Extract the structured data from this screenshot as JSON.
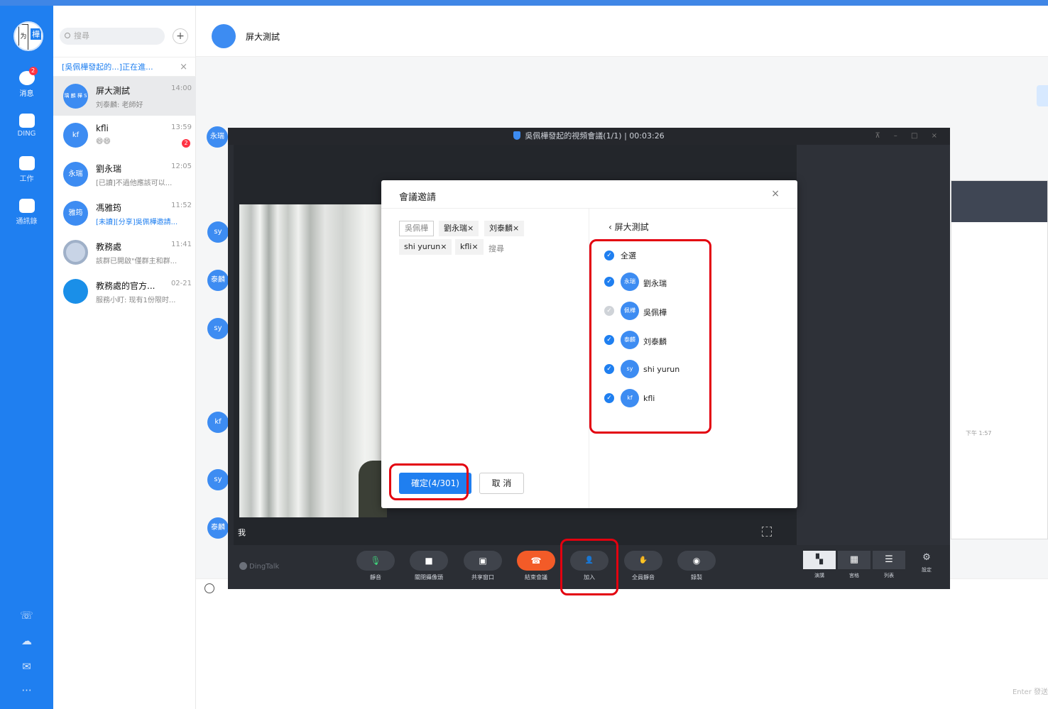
{
  "nav": {
    "avatar_text": "樺",
    "avatar_card": "为",
    "items": [
      {
        "label": "消息",
        "badge": "2"
      },
      {
        "label": "DING"
      },
      {
        "label": "工作"
      },
      {
        "label": "通訊錄"
      }
    ],
    "more": "···"
  },
  "list": {
    "search_placeholder": "搜尋",
    "plus": "+",
    "meeting_bar": "[吳佩樺發起的...]正在進...",
    "meeting_close": "×",
    "conversations": [
      {
        "name": "屏大測試",
        "preview": "刘泰麟: 老師好",
        "time": "14:00",
        "avatar": "瑀 麟 樺 S"
      },
      {
        "name": "kfli",
        "preview": "😄😄",
        "time": "13:59",
        "avatar": "kf",
        "count": "2"
      },
      {
        "name": "劉永瑞",
        "preview": "[已讀]不過他應該可以...",
        "time": "12:05",
        "avatar": "永瑞"
      },
      {
        "name": "馮雅筠",
        "preview": "[未讀][分享]吳佩樺邀請...",
        "time": "11:52",
        "avatar": "雅筠"
      },
      {
        "name": "教務處",
        "preview": "該群已開啟\"僅群主和群...",
        "time": "11:41",
        "avatar": ""
      },
      {
        "name": "教務處的官方...",
        "preview": "服務小盯: 现有1份限时...",
        "time": "02-21",
        "avatar": ""
      }
    ]
  },
  "chat": {
    "title": "屏大測試",
    "side_avatars": [
      "永瑞",
      "sy",
      "泰麟",
      "sy",
      "kf",
      "sy",
      "泰麟"
    ],
    "enter_hint": "Enter 發送",
    "panel_time": "下午 1:57"
  },
  "video": {
    "title": "吳佩樺發起的視頻會議(1/1) | 00:03:26",
    "window_controls": "⊼ – □ ×",
    "me_label": "我",
    "brand": "DingTalk",
    "buttons": [
      {
        "label": "靜音",
        "glyph": "🎙"
      },
      {
        "label": "關閉攝像頭",
        "glyph": "■"
      },
      {
        "label": "共享窗口",
        "glyph": "▣"
      },
      {
        "label": "結束會議",
        "glyph": "☎"
      },
      {
        "label": "加入",
        "glyph": "👤"
      },
      {
        "label": "全員靜音",
        "glyph": "✋"
      },
      {
        "label": "錄製",
        "glyph": "◉"
      }
    ],
    "layouts": [
      {
        "label": "演講",
        "glyph": "▚"
      },
      {
        "label": "宮格",
        "glyph": "▦"
      },
      {
        "label": "列表",
        "glyph": "☰"
      },
      {
        "label": "設定",
        "glyph": "⚙"
      }
    ]
  },
  "dialog": {
    "title": "會議邀請",
    "close": "×",
    "chips": [
      "吳佩樺",
      "劉永瑞×",
      "刘泰麟×",
      "shi yurun×",
      "kfli×"
    ],
    "chip_search": "搜尋",
    "confirm": "確定(4/301)",
    "cancel": "取 消",
    "back": "‹ 屏大測試",
    "select_all": "全選",
    "members": [
      {
        "name": "劉永瑞",
        "avatar": "永瑞",
        "checked": true
      },
      {
        "name": "吳佩樺",
        "avatar": "佩樺",
        "checked": false
      },
      {
        "name": "刘泰麟",
        "avatar": "泰麟",
        "checked": true
      },
      {
        "name": "shi yurun",
        "avatar": "sy",
        "checked": true
      },
      {
        "name": "kfli",
        "avatar": "kf",
        "checked": true
      }
    ]
  },
  "colors": {
    "primary": "#1f7ff0",
    "end_call": "#f35b28",
    "highlight": "#e3000f",
    "meeting_bg": "#2a2d33"
  }
}
